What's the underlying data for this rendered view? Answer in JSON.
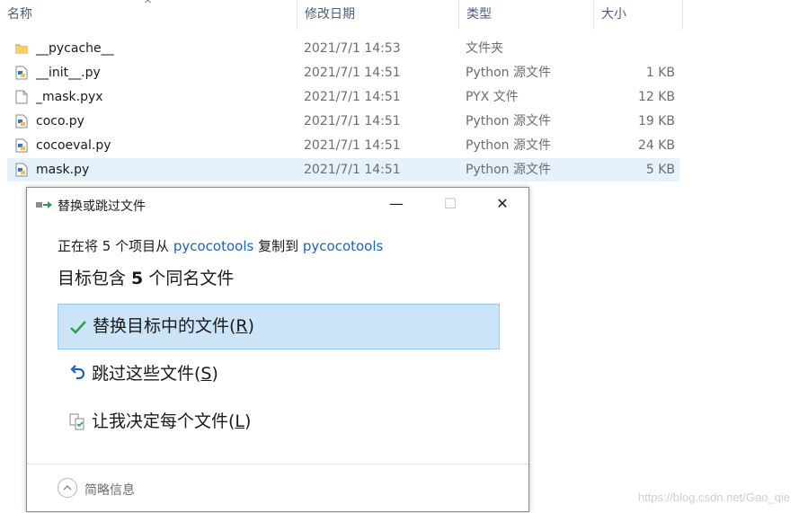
{
  "explorer": {
    "columns": {
      "name": "名称",
      "date": "修改日期",
      "type": "类型",
      "size": "大小"
    },
    "files": [
      {
        "icon": "folder-icon",
        "name": "__pycache__",
        "date": "2021/7/1 14:53",
        "type": "文件夹",
        "size": "",
        "selected": false
      },
      {
        "icon": "python-file-icon",
        "name": "__init__.py",
        "date": "2021/7/1 14:51",
        "type": "Python 源文件",
        "size": "1 KB",
        "selected": false
      },
      {
        "icon": "blank-file-icon",
        "name": "_mask.pyx",
        "date": "2021/7/1 14:51",
        "type": "PYX 文件",
        "size": "12 KB",
        "selected": false
      },
      {
        "icon": "python-file-icon",
        "name": "coco.py",
        "date": "2021/7/1 14:51",
        "type": "Python 源文件",
        "size": "19 KB",
        "selected": false
      },
      {
        "icon": "python-file-icon",
        "name": "cocoeval.py",
        "date": "2021/7/1 14:51",
        "type": "Python 源文件",
        "size": "24 KB",
        "selected": false
      },
      {
        "icon": "python-file-icon",
        "name": "mask.py",
        "date": "2021/7/1 14:51",
        "type": "Python 源文件",
        "size": "5 KB",
        "selected": true
      }
    ]
  },
  "dialog": {
    "title": "替换或跳过文件",
    "window_controls": {
      "minimize": "—",
      "maximize": "☐",
      "close": "✕"
    },
    "copy_line": {
      "prefix": "正在将 5 个项目从 ",
      "source": "pycocotools",
      "middle": " 复制到 ",
      "dest": "pycocotools"
    },
    "headline": {
      "prefix": "目标包含 ",
      "count": "5",
      "suffix": " 个同名文件"
    },
    "options": [
      {
        "icon": "checkmark-icon",
        "label": "替换目标中的文件(",
        "key": "R",
        "end": ")"
      },
      {
        "icon": "skip-arrow-icon",
        "label": "跳过这些文件(",
        "key": "S",
        "end": ")"
      },
      {
        "icon": "compare-files-icon",
        "label": "让我决定每个文件(",
        "key": "L",
        "end": ")"
      }
    ],
    "details_label": "简略信息"
  },
  "watermark": "https://blog.csdn.net/Gao_qie",
  "colors": {
    "accent": "#1e63b4",
    "selected_row": "#e5f1fb",
    "active_option": "#cce4f7",
    "check": "#2e9e4a"
  }
}
